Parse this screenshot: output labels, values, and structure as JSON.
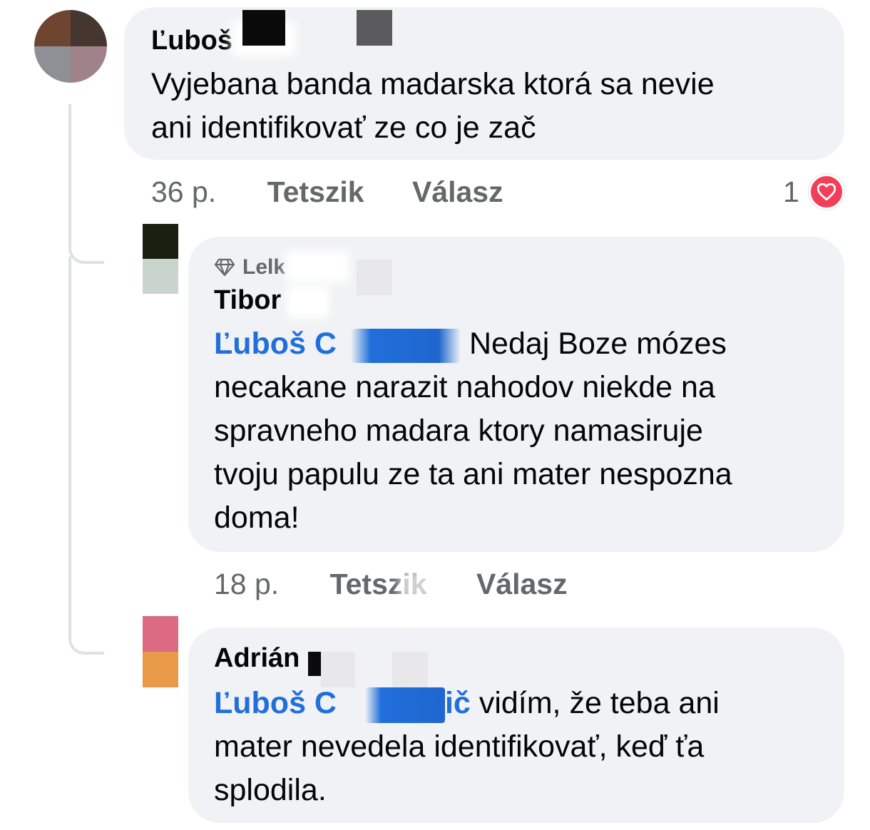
{
  "comments": [
    {
      "author": "Ľuboš",
      "text_lines": [
        "Vyjebana  banda madarska  ktorá sa nevie",
        "ani identifikovať ze co je zač"
      ],
      "time": "36 p.",
      "like_label": "Tetszik",
      "reply_label": "Válasz",
      "reaction_count": "1",
      "reaction_icon": "heart-icon"
    }
  ],
  "replies": [
    {
      "badge_icon": "diamond-icon",
      "badge_label": "Lelk",
      "author": "Tibor",
      "mention": "Ľuboš C",
      "text_first": "Nedaj Boze mózes",
      "text_lines": [
        "necakane narazit nahodov niekde na",
        "spravneho madara ktory namasiruje",
        "tvoju papulu ze ta ani mater nespozna",
        "doma!"
      ],
      "time": "18 p.",
      "like_label": "Tetszik",
      "reply_label": "Válasz"
    },
    {
      "author": "Adrián",
      "mention_start": "Ľuboš C",
      "mention_end": "ič",
      "text_first": "vidím, že teba ani",
      "text_lines": [
        "mater nevedela identifikovať,  keď ťa",
        "splodila."
      ]
    }
  ],
  "colors": {
    "bubble": "#f0f2f5",
    "mention": "#216fdb",
    "meta": "#65676b",
    "heart": "#f33e58",
    "line": "#dfe1e5"
  }
}
